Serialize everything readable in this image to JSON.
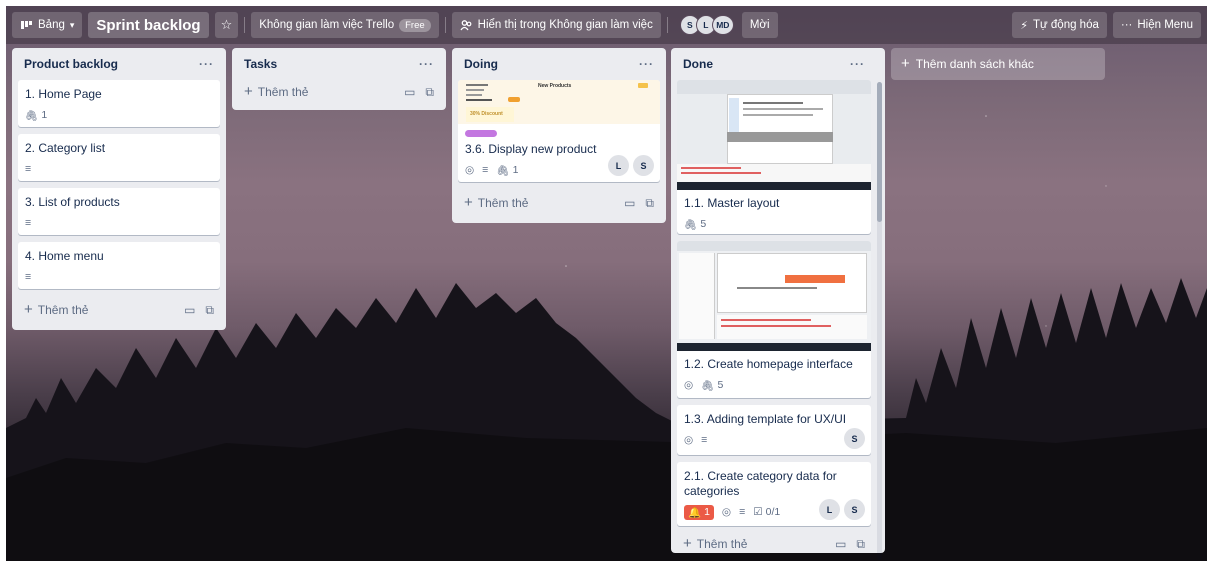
{
  "header": {
    "view_label": "Bảng",
    "board_title": "Sprint backlog",
    "workspace_label": "Không gian làm việc Trello",
    "workspace_badge": "Free",
    "visibility_label": "Hiển thị trong Không gian làm việc",
    "members": [
      "S",
      "L",
      "MD"
    ],
    "invite_label": "Mời",
    "automation_label": "Tự động hóa",
    "menu_label": "Hiện Menu"
  },
  "add_card_label": "Thêm thẻ",
  "add_list_label": "Thêm danh sách khác",
  "lists": [
    {
      "title": "Product backlog",
      "cards": [
        {
          "title": "1. Home Page",
          "attachments": "1"
        },
        {
          "title": "2. Category list"
        },
        {
          "title": "3. List of products"
        },
        {
          "title": "4. Home menu"
        }
      ]
    },
    {
      "title": "Tasks",
      "cards": []
    },
    {
      "title": "Doing",
      "cards": [
        {
          "title": "3.6. Display new product",
          "attachments": "1",
          "members": [
            "L",
            "S"
          ],
          "label_color": "#c377e0",
          "cover_text": "New Products",
          "cover_sub": "30% Discount"
        }
      ]
    },
    {
      "title": "Done",
      "cards": [
        {
          "title": "1.1. Master layout",
          "attachments": "5"
        },
        {
          "title": "1.2. Create homepage interface",
          "attachments": "5"
        },
        {
          "title": "1.3. Adding template for UX/UI",
          "members": [
            "S"
          ]
        },
        {
          "title": "2.1. Create category data for categories",
          "due": "1",
          "checklist": "0/1",
          "members": [
            "L",
            "S"
          ]
        }
      ]
    }
  ],
  "colors": {
    "list_bg": "#ebecf0",
    "due_red": "#eb5a46",
    "label_purple": "#c377e0"
  }
}
